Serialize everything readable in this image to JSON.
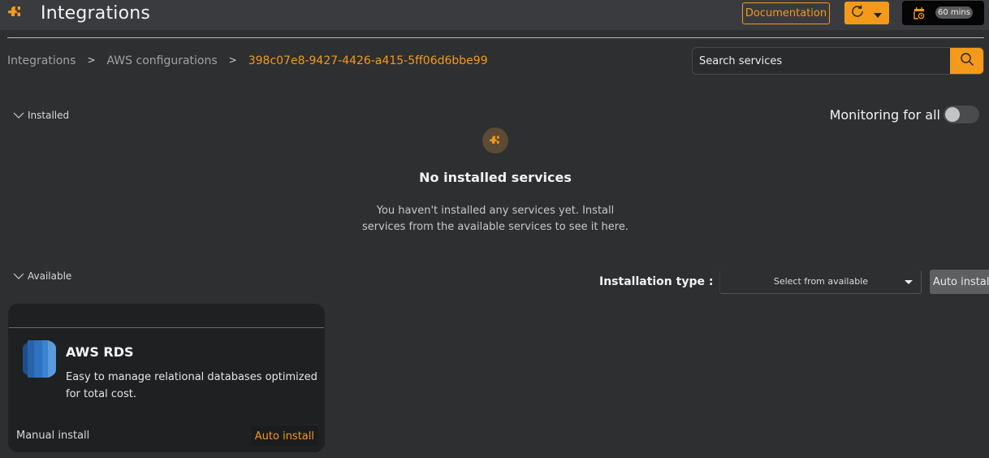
{
  "header": {
    "title": "Integrations",
    "app_icon": "puzzle-piece-icon",
    "documentation_label": "Documentation",
    "refresh_icon": "refresh-icon",
    "dropdown_icon": "caret-down-icon",
    "time_range_icon": "calendar-clock-icon",
    "time_range_label": "60 mins"
  },
  "breadcrumb": {
    "items": [
      "Integrations",
      "AWS configurations",
      "398c07e8-9427-4426-a415-5ff06d6bbe99"
    ],
    "separator": ">"
  },
  "search": {
    "placeholder": "Search services",
    "value": "",
    "icon": "search-icon"
  },
  "installed": {
    "section_label": "Installed",
    "monitoring_label": "Monitoring for all",
    "monitoring_enabled": false,
    "empty_title": "No installed services",
    "empty_description": "You haven't installed any services yet. Install services from the available services to see it here."
  },
  "available": {
    "section_label": "Available",
    "installation_type_label": "Installation type :",
    "installation_type_selected": "Select from available",
    "auto_install_label": "Auto install",
    "services": [
      {
        "name": "AWS RDS",
        "icon": "aws-rds-icon",
        "description": "Easy to manage relational databases optimized for total cost.",
        "manual_install_label": "Manual install",
        "auto_install_label": "Auto install"
      }
    ]
  },
  "colors": {
    "accent": "#f39a1b",
    "background": "#2e2f31",
    "topbar": "#3a3b3e",
    "card": "#1f2022"
  }
}
